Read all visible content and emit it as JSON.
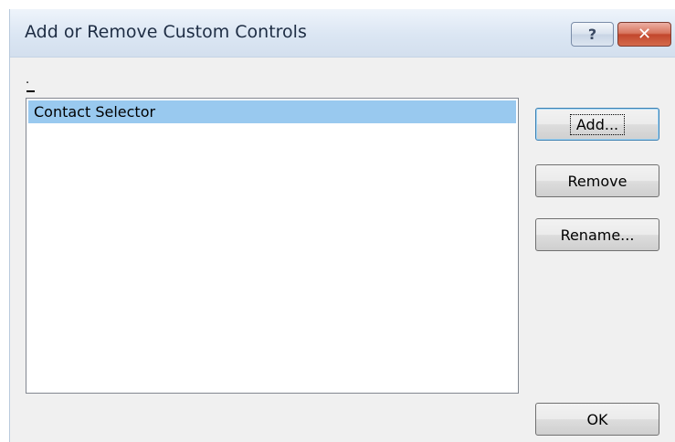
{
  "window": {
    "title": "Add or Remove Custom Controls",
    "help_label": "?",
    "close_label": "✕"
  },
  "marks": {
    "dot": "."
  },
  "list": {
    "items": [
      {
        "label": "Contact Selector",
        "selected": true
      }
    ]
  },
  "buttons": {
    "add_label": "Add...",
    "remove_label": "Remove",
    "rename_label": "Rename...",
    "ok_label": "OK"
  },
  "colors": {
    "selection": "#99c9ef",
    "titlebar": "#dbe6f3",
    "close": "#c2472d"
  }
}
